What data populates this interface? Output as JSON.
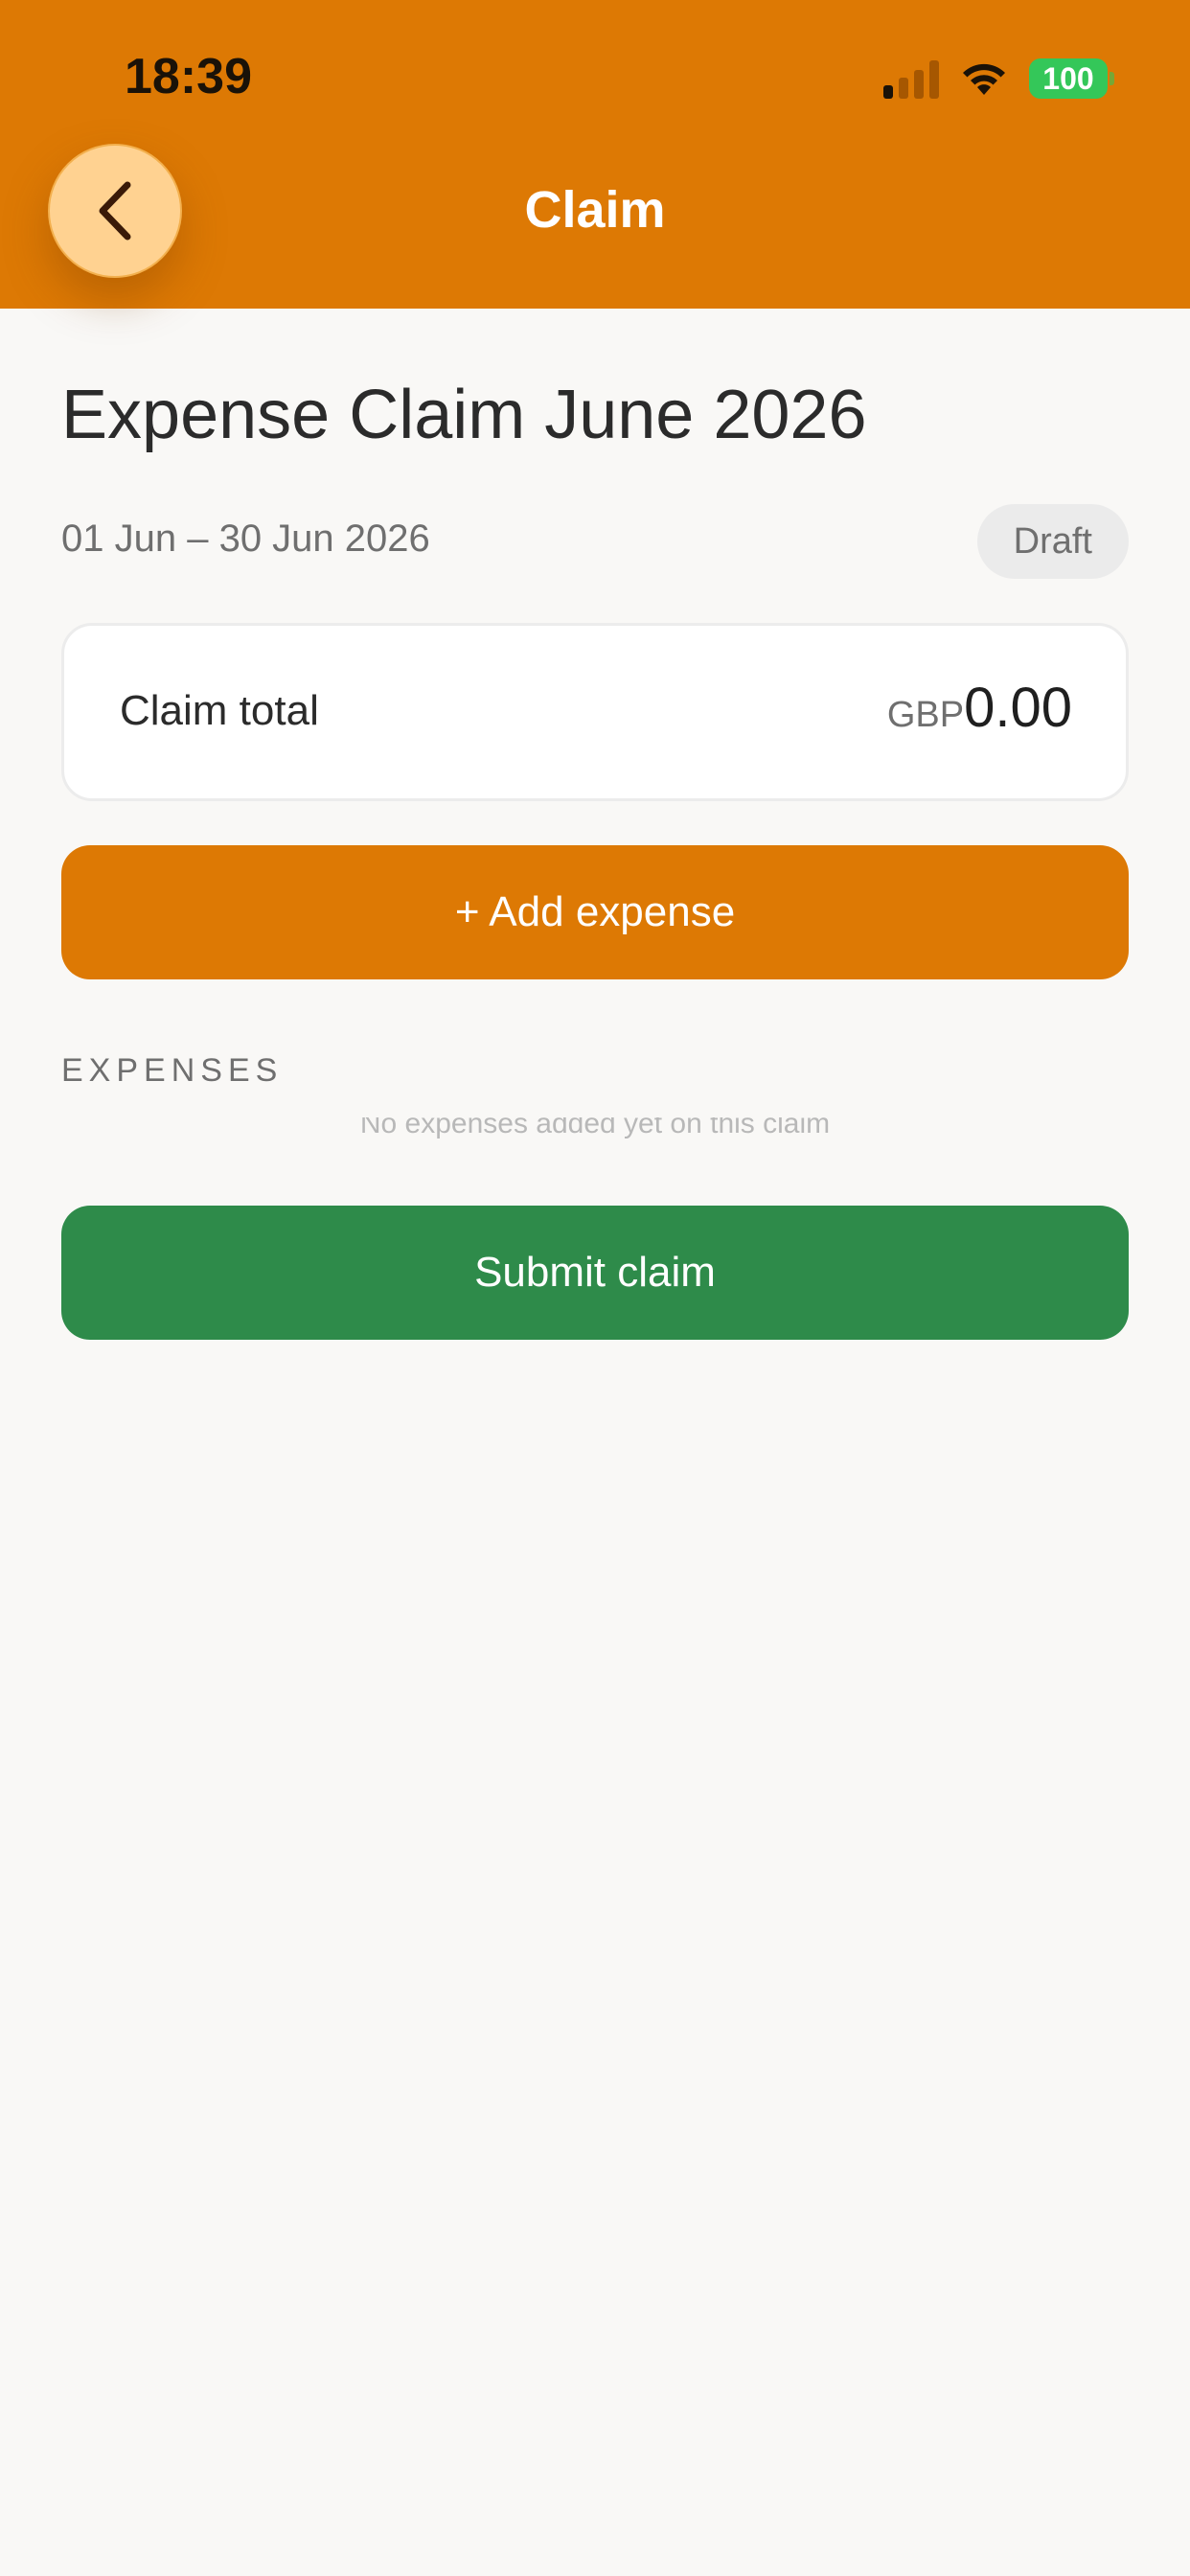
{
  "status_bar": {
    "time": "18:39",
    "battery": "100"
  },
  "header": {
    "title": "Claim",
    "back_icon": "chevron-left-icon"
  },
  "claim": {
    "title": "Expense Claim June 2026",
    "period": "01 Jun – 30 Jun 2026",
    "status": "Draft",
    "total_label": "Claim total",
    "currency": "GBP",
    "total_value": "0.00"
  },
  "actions": {
    "add_expense_label": "+ Add expense",
    "submit_label": "Submit claim"
  },
  "expenses": {
    "section_label": "EXPENSES",
    "empty_text": "No expenses added yet on this claim"
  },
  "colors": {
    "accent": "#dd7904",
    "success": "#2e8b4a",
    "back_button": "#ffd291",
    "battery": "#34c759"
  }
}
